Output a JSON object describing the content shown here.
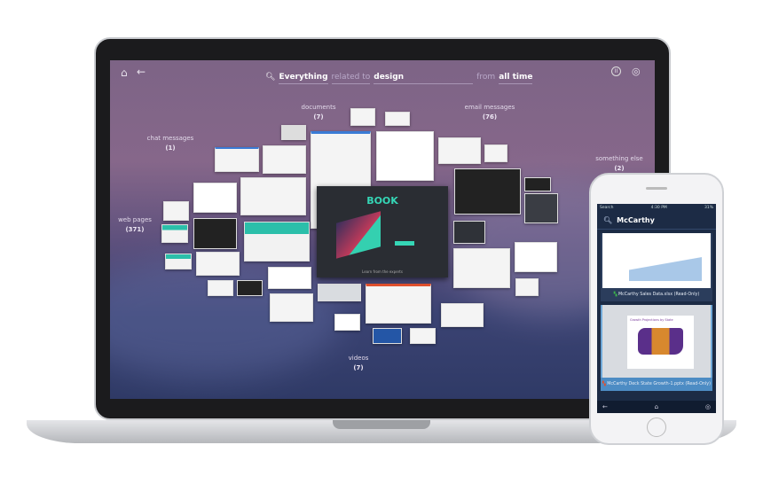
{
  "search": {
    "scope": "Everything",
    "connector": "related to",
    "query": "design",
    "time_prefix": "from",
    "time_value": "all time"
  },
  "icons": {
    "home": "home-icon",
    "back": "arrow-left-icon",
    "pause": "pause-icon",
    "account": "user-circle-icon",
    "search": "search-icon"
  },
  "categories": [
    {
      "label": "documents",
      "count": "(7)"
    },
    {
      "label": "email messages",
      "count": "(76)"
    },
    {
      "label": "chat messages",
      "count": "(1)"
    },
    {
      "label": "something else",
      "count": "(2)"
    },
    {
      "label": "web pages",
      "count": "(371)"
    },
    {
      "label": "videos",
      "count": "(7)"
    }
  ],
  "hero": {
    "title": "BOOK",
    "footer": "Learn from the experts"
  },
  "phone": {
    "status": {
      "carrier": "Search",
      "time": "4:30 PM",
      "battery": "31%"
    },
    "query": "McCarthy",
    "results": [
      {
        "caption": "McCarthy Sales Data.xlsx (Read-Only)"
      },
      {
        "caption": "McCarthy Deck State Growth-1.pptx (Read-Only)",
        "slide_title": "Growth Projections by State"
      }
    ]
  },
  "colors": {
    "accent": "#35d6b6",
    "phone_bg": "#1c2b45"
  }
}
